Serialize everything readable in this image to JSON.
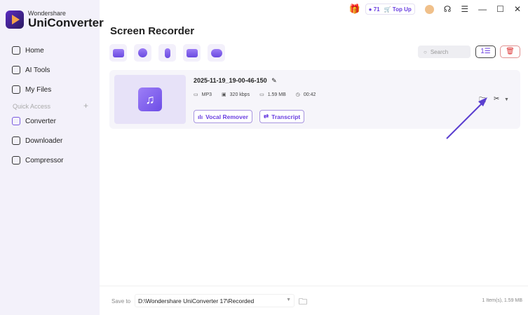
{
  "app": {
    "brand_small": "Wondershare",
    "brand_big": "UniConverter"
  },
  "sidebar": {
    "items": [
      {
        "label": "Home"
      },
      {
        "label": "AI Tools"
      },
      {
        "label": "My Files"
      }
    ],
    "quick_access": "Quick Access",
    "quick_add": "+",
    "quick_items": [
      {
        "label": "Converter"
      },
      {
        "label": "Downloader"
      },
      {
        "label": "Compressor"
      }
    ]
  },
  "topbar": {
    "credits": "71",
    "top_up": "Top Up"
  },
  "page": {
    "title": "Screen Recorder",
    "search_placeholder": "Search"
  },
  "file": {
    "name": "2025-11-19_19-00-46-150",
    "format": "MP3",
    "bitrate": "320 kbps",
    "size": "1.59 MB",
    "duration": "00:42",
    "vocal_remover": "Vocal Remover",
    "transcript": "Transcript"
  },
  "footer": {
    "save_to": "Save to",
    "path": "D:\\Wondershare UniConverter 17\\Recorded",
    "summary": "1 Item(s), 1.59 MB"
  },
  "colors": {
    "accent": "#6a3fe0",
    "annotation": "#5b3fd0"
  }
}
